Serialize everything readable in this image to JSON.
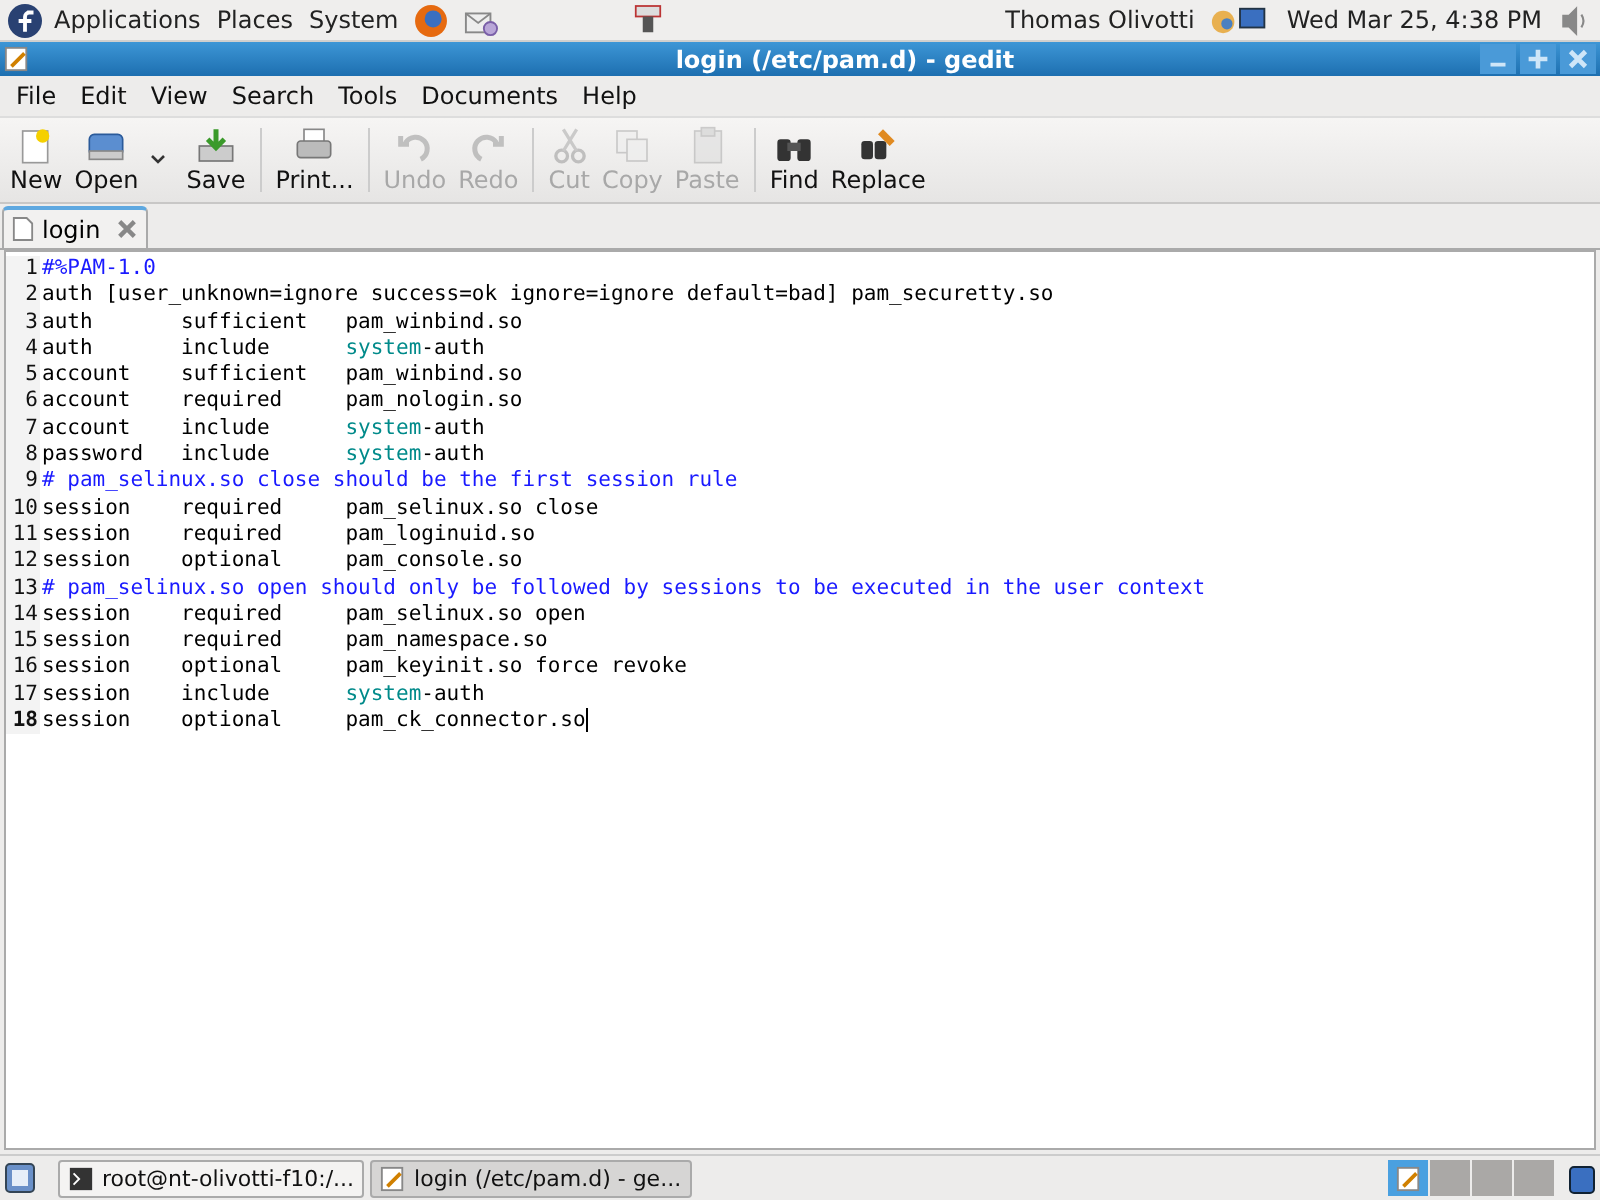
{
  "top_panel": {
    "menus": [
      "Applications",
      "Places",
      "System"
    ],
    "user": "Thomas Olivotti",
    "clock": "Wed Mar 25,  4:38 PM"
  },
  "window": {
    "title": "login (/etc/pam.d) - gedit"
  },
  "menu_bar": [
    "File",
    "Edit",
    "View",
    "Search",
    "Tools",
    "Documents",
    "Help"
  ],
  "toolbar": [
    {
      "label": "New",
      "disabled": false
    },
    {
      "label": "Open",
      "disabled": false
    },
    {
      "label": "Save",
      "disabled": false
    },
    {
      "label": "Print...",
      "disabled": false
    },
    {
      "label": "Undo",
      "disabled": true
    },
    {
      "label": "Redo",
      "disabled": true
    },
    {
      "label": "Cut",
      "disabled": true
    },
    {
      "label": "Copy",
      "disabled": true
    },
    {
      "label": "Paste",
      "disabled": true
    },
    {
      "label": "Find",
      "disabled": false
    },
    {
      "label": "Replace",
      "disabled": false
    }
  ],
  "tabs": [
    {
      "label": "login",
      "selected": true
    }
  ],
  "editor": {
    "lines": [
      {
        "number": "1",
        "current": false,
        "segments": [
          {
            "text": "#%PAM-1.0",
            "kind": "comment"
          }
        ]
      },
      {
        "number": "2",
        "current": false,
        "segments": [
          {
            "text": "auth [user_unknown=ignore success=ok ignore=ignore default=bad] pam_securetty.so",
            "kind": "plain"
          }
        ]
      },
      {
        "number": "3",
        "current": false,
        "segments": [
          {
            "text": "auth       sufficient   pam_winbind.so",
            "kind": "plain"
          }
        ]
      },
      {
        "number": "4",
        "current": false,
        "segments": [
          {
            "text": "auth       include      ",
            "kind": "plain"
          },
          {
            "text": "system",
            "kind": "keyword"
          },
          {
            "text": "-auth",
            "kind": "plain"
          }
        ]
      },
      {
        "number": "5",
        "current": false,
        "segments": [
          {
            "text": "account    sufficient   pam_winbind.so",
            "kind": "plain"
          }
        ]
      },
      {
        "number": "6",
        "current": false,
        "segments": [
          {
            "text": "account    required     pam_nologin.so",
            "kind": "plain"
          }
        ]
      },
      {
        "number": "7",
        "current": false,
        "segments": [
          {
            "text": "account    include      ",
            "kind": "plain"
          },
          {
            "text": "system",
            "kind": "keyword"
          },
          {
            "text": "-auth",
            "kind": "plain"
          }
        ]
      },
      {
        "number": "8",
        "current": false,
        "segments": [
          {
            "text": "password   include      ",
            "kind": "plain"
          },
          {
            "text": "system",
            "kind": "keyword"
          },
          {
            "text": "-auth",
            "kind": "plain"
          }
        ]
      },
      {
        "number": "9",
        "current": false,
        "segments": [
          {
            "text": "# pam_selinux.so close should be the first session rule",
            "kind": "comment"
          }
        ]
      },
      {
        "number": "10",
        "current": false,
        "segments": [
          {
            "text": "session    required     pam_selinux.so close",
            "kind": "plain"
          }
        ]
      },
      {
        "number": "11",
        "current": false,
        "segments": [
          {
            "text": "session    required     pam_loginuid.so",
            "kind": "plain"
          }
        ]
      },
      {
        "number": "12",
        "current": false,
        "segments": [
          {
            "text": "session    optional     pam_console.so",
            "kind": "plain"
          }
        ]
      },
      {
        "number": "13",
        "current": false,
        "segments": [
          {
            "text": "# pam_selinux.so open should only be followed by sessions to be executed in the user context",
            "kind": "comment"
          }
        ]
      },
      {
        "number": "14",
        "current": false,
        "segments": [
          {
            "text": "session    required     pam_selinux.so open",
            "kind": "plain"
          }
        ]
      },
      {
        "number": "15",
        "current": false,
        "segments": [
          {
            "text": "session    required     pam_namespace.so",
            "kind": "plain"
          }
        ]
      },
      {
        "number": "16",
        "current": false,
        "segments": [
          {
            "text": "session    optional     pam_keyinit.so force revoke",
            "kind": "plain"
          }
        ]
      },
      {
        "number": "17",
        "current": false,
        "segments": [
          {
            "text": "session    include      ",
            "kind": "plain"
          },
          {
            "text": "system",
            "kind": "keyword"
          },
          {
            "text": "-auth",
            "kind": "plain"
          }
        ]
      },
      {
        "number": "18",
        "current": true,
        "segments": [
          {
            "text": "session    optional     pam_ck_connector.so",
            "kind": "plain"
          }
        ]
      }
    ]
  },
  "taskbar": [
    {
      "label": "root@nt-olivotti-f10:/...",
      "selected": false
    },
    {
      "label": "login (/etc/pam.d) - ge...",
      "selected": true
    }
  ]
}
